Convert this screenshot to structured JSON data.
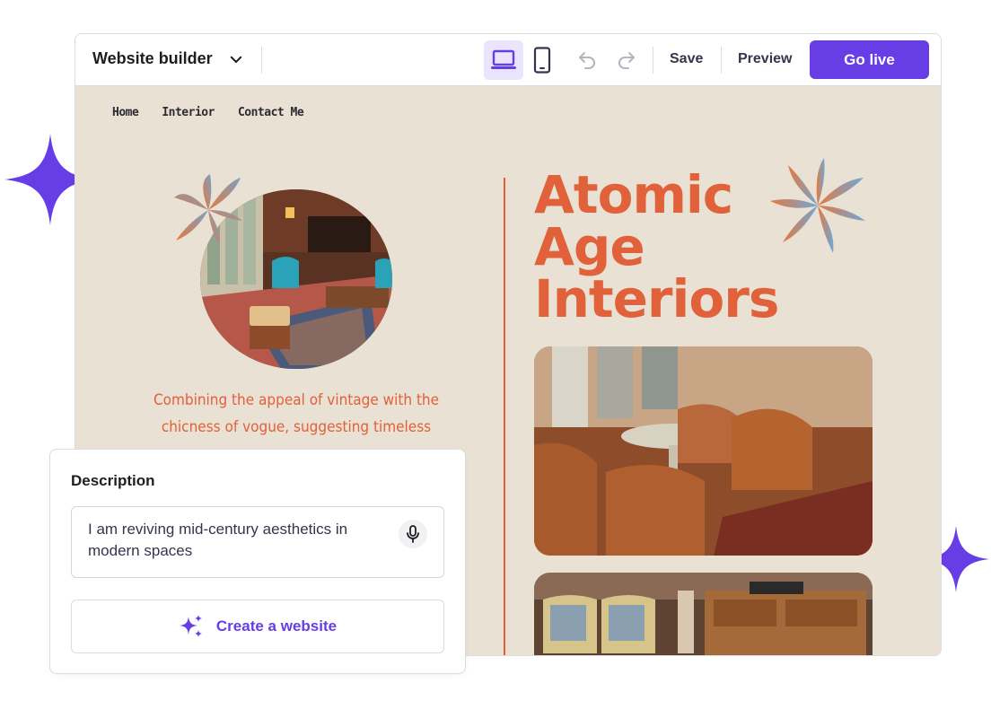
{
  "colors": {
    "accent": "#673de6",
    "accent_soft": "#ebe4ff",
    "canvas_bg": "#e9e1d3",
    "hero_orange": "#e1613b"
  },
  "icons": {
    "sparkle": "sparkle-icon",
    "chevron": "chevron-down-icon",
    "desktop": "laptop-icon",
    "mobile": "mobile-icon",
    "undo": "undo-icon",
    "redo": "redo-icon",
    "mic": "microphone-icon",
    "ai": "ai-sparkles-icon"
  },
  "toolbar": {
    "title": "Website builder",
    "save_label": "Save",
    "preview_label": "Preview",
    "golive_label": "Go live"
  },
  "site": {
    "nav": [
      "Home",
      "Interior",
      "Contact Me"
    ],
    "title_lines": [
      "Atomic",
      "Age",
      "Interiors"
    ],
    "tagline_lines": [
      "Combining the appeal of vintage with the",
      "chicness of vogue, suggesting timeless"
    ]
  },
  "description_card": {
    "title": "Description",
    "value": "I am reviving mid-century aesthetics in modern spaces",
    "create_label": "Create a website"
  }
}
